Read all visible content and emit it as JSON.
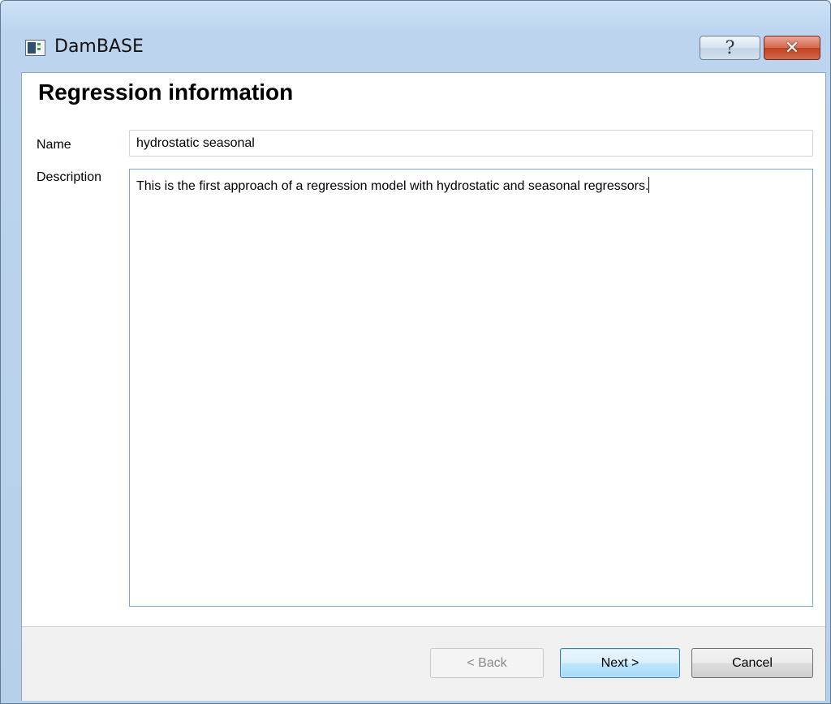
{
  "window": {
    "title": "DamBASE",
    "help_glyph": "?",
    "close_glyph": "✕"
  },
  "page": {
    "title": "Regression information"
  },
  "form": {
    "name_label": "Name",
    "name_value": "hydrostatic seasonal",
    "description_label": "Description",
    "description_value": "This is the first approach of a regression model with hydrostatic and seasonal regressors."
  },
  "buttons": {
    "back": "< Back",
    "next": "Next >",
    "cancel": "Cancel"
  },
  "icons": {
    "app": "app-window-icon",
    "help": "help-icon",
    "close": "close-icon"
  }
}
